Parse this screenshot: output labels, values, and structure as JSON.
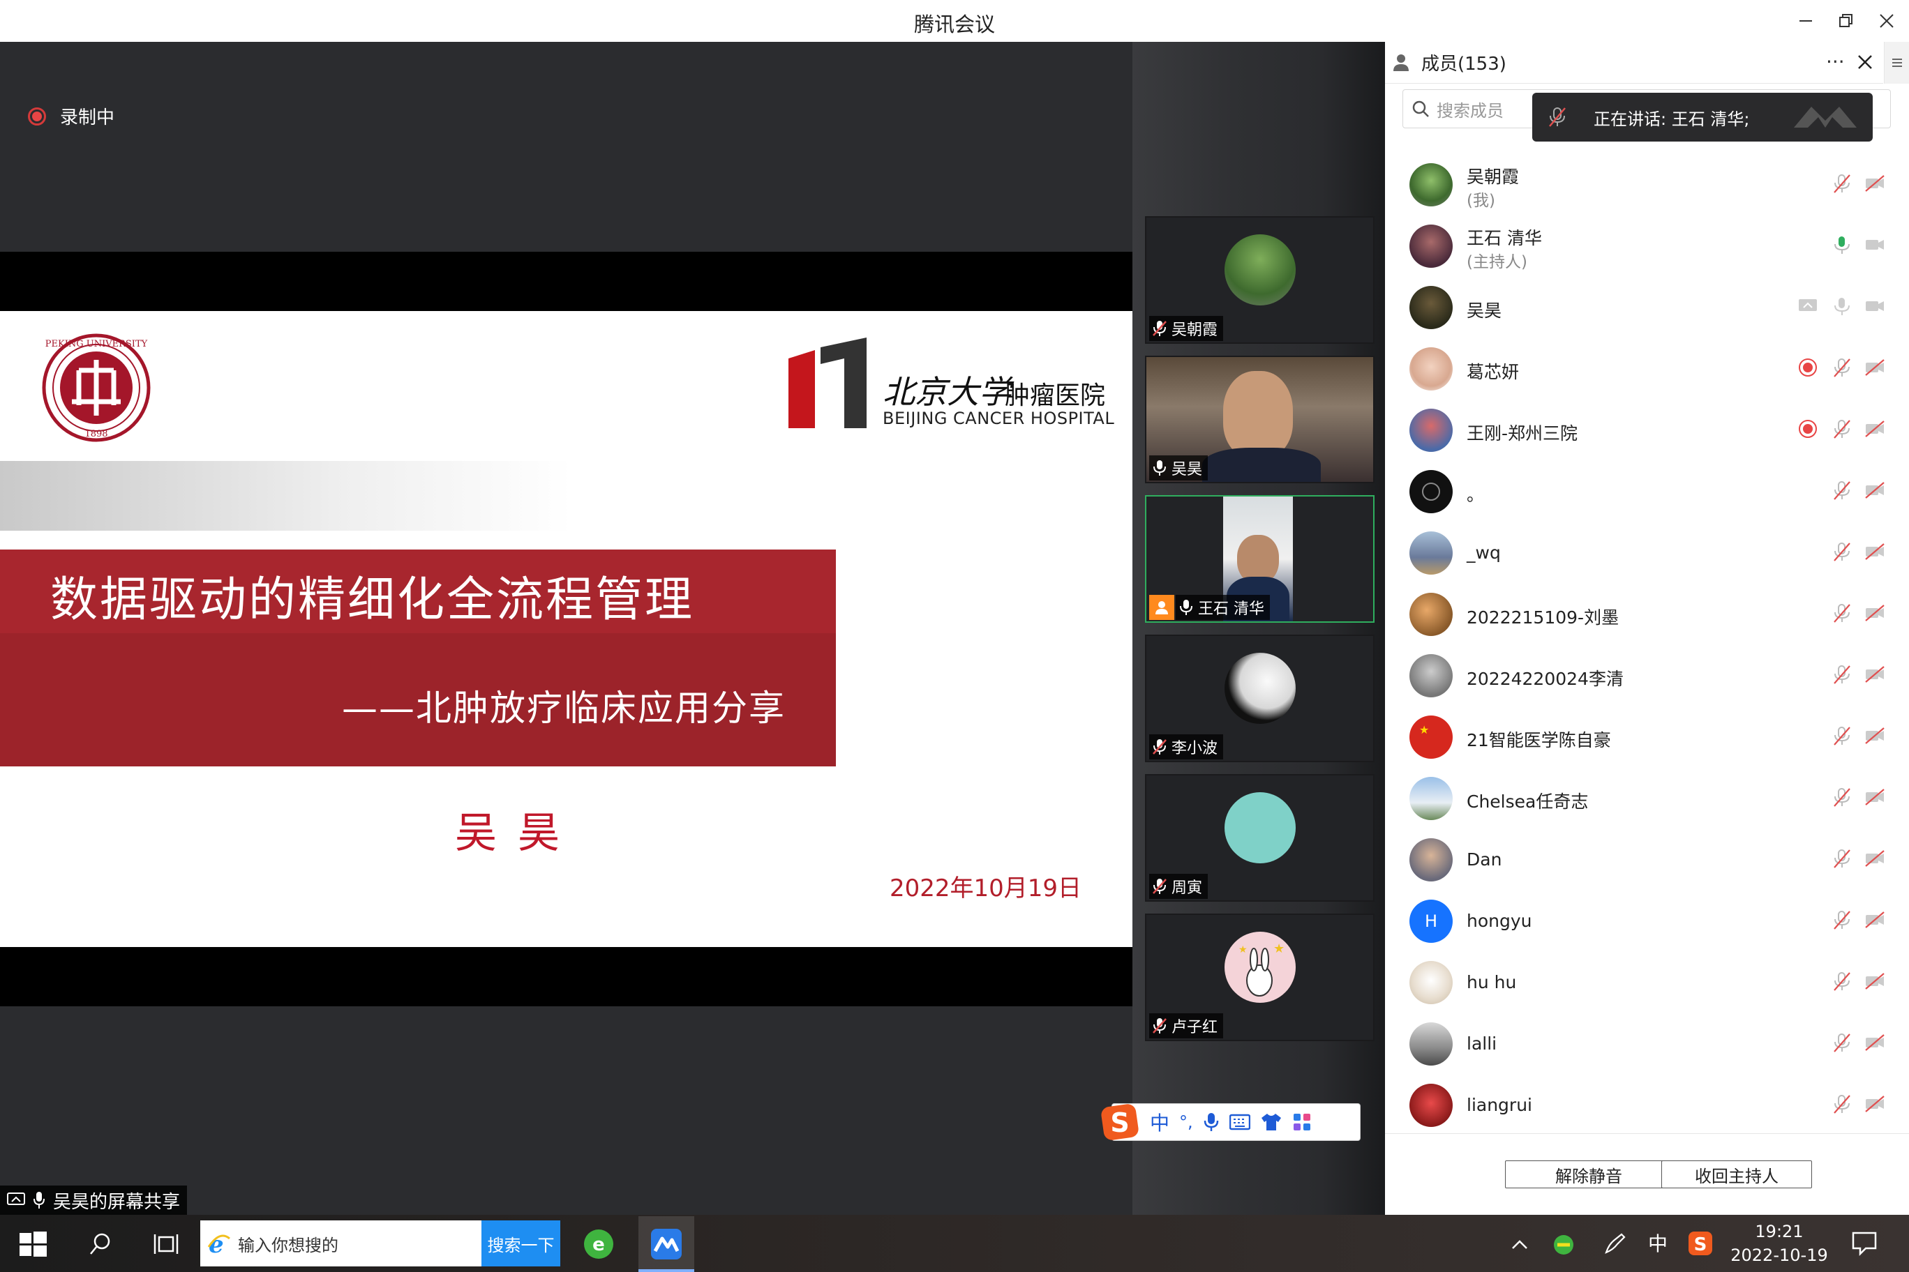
{
  "window": {
    "title": "腾讯会议"
  },
  "recording": {
    "label": "录制中"
  },
  "slide": {
    "hospital_name_cn": "肿瘤医院",
    "hospital_calligraphy": "北京大学",
    "hospital_name_en": "BEIJING CANCER HOSPITAL",
    "title": "数据驱动的精细化全流程管理",
    "subtitle": "——北肿放疗临床应用分享",
    "author": "吴昊",
    "date": "2022年10月19日",
    "seal_text": "PEKING UNIVERSITY",
    "seal_year": "1898"
  },
  "video_tiles": [
    {
      "name": "吴朝霞",
      "mic": "muted",
      "active": false,
      "host": false
    },
    {
      "name": "吴昊",
      "mic": "on",
      "active": false,
      "host": false
    },
    {
      "name": "王石 清华",
      "mic": "on",
      "active": true,
      "host": true
    },
    {
      "name": "李小波",
      "mic": "muted",
      "active": false,
      "host": false
    },
    {
      "name": "周寅",
      "mic": "muted",
      "active": false,
      "host": false
    },
    {
      "name": "卢子红",
      "mic": "muted",
      "active": false,
      "host": false
    }
  ],
  "share_label": "吴昊的屏幕共享",
  "members_panel": {
    "header": "成员(153)",
    "search_placeholder": "搜索成员",
    "speaking_toast": "正在讲话: 王石 清华;",
    "members": [
      {
        "name": "吴朝霞",
        "role": "(我)",
        "recording": false,
        "mic": "muted",
        "video": "off",
        "avatar_color": "#5c8a4a"
      },
      {
        "name": "王石 清华",
        "role": "(主持人)",
        "recording": false,
        "mic": "on",
        "video": "off",
        "avatar_color": "#6b3a3a"
      },
      {
        "name": "吴昊",
        "role": "",
        "recording": false,
        "mic": "neutral",
        "video": "off",
        "screen_share": true,
        "avatar_color": "#4a3a2a"
      },
      {
        "name": "葛芯妍",
        "role": "",
        "recording": true,
        "mic": "muted",
        "video": "off",
        "avatar_color": "#e8c3b0"
      },
      {
        "name": "王刚-郑州三院",
        "role": "",
        "recording": true,
        "mic": "muted",
        "video": "off",
        "avatar_color": "#c24a4a"
      },
      {
        "name": "。",
        "role": "",
        "recording": false,
        "mic": "muted",
        "video": "off",
        "avatar_color": "#111111"
      },
      {
        "name": "_wq",
        "role": "",
        "recording": false,
        "mic": "muted",
        "video": "off",
        "avatar_color": "#7a8fb0"
      },
      {
        "name": "2022215109-刘墨",
        "role": "",
        "recording": false,
        "mic": "muted",
        "video": "off",
        "avatar_color": "#c87a3a"
      },
      {
        "name": "20224220024李清",
        "role": "",
        "recording": false,
        "mic": "muted",
        "video": "off",
        "avatar_color": "#9a9a9a"
      },
      {
        "name": "21智能医学陈自豪",
        "role": "",
        "recording": false,
        "mic": "muted",
        "video": "off",
        "avatar_color": "#d6281e"
      },
      {
        "name": "Chelsea任奇志",
        "role": "",
        "recording": false,
        "mic": "muted",
        "video": "off",
        "avatar_color": "#8fb4d8"
      },
      {
        "name": "Dan",
        "role": "",
        "recording": false,
        "mic": "muted",
        "video": "off",
        "avatar_color": "#c8a488"
      },
      {
        "name": "hongyu",
        "role": "",
        "recording": false,
        "mic": "muted",
        "video": "off",
        "avatar_letter": "H",
        "avatar_color": "#1673ff"
      },
      {
        "name": "hu hu",
        "role": "",
        "recording": false,
        "mic": "muted",
        "video": "off",
        "avatar_color": "#e8ded0"
      },
      {
        "name": "lalli",
        "role": "",
        "recording": false,
        "mic": "muted",
        "video": "off",
        "avatar_color": "#8a8a8a"
      },
      {
        "name": "liangrui",
        "role": "",
        "recording": false,
        "mic": "muted",
        "video": "off",
        "avatar_color": "#b42a2a"
      }
    ],
    "buttons": {
      "unmute": "解除静音",
      "reclaim_host": "收回主持人"
    }
  },
  "ime_toolbar": {
    "lang": "中",
    "punct": "°,"
  },
  "taskbar": {
    "search_placeholder": "输入你想搜的",
    "search_button": "搜索一下",
    "ime_lang": "中",
    "time": "19:21",
    "date": "2022-10-19"
  },
  "colors": {
    "accent_green": "#2fae5e",
    "recording_red": "#e84545",
    "slide_red": "#9c232a",
    "muted_red": "#e05050"
  }
}
